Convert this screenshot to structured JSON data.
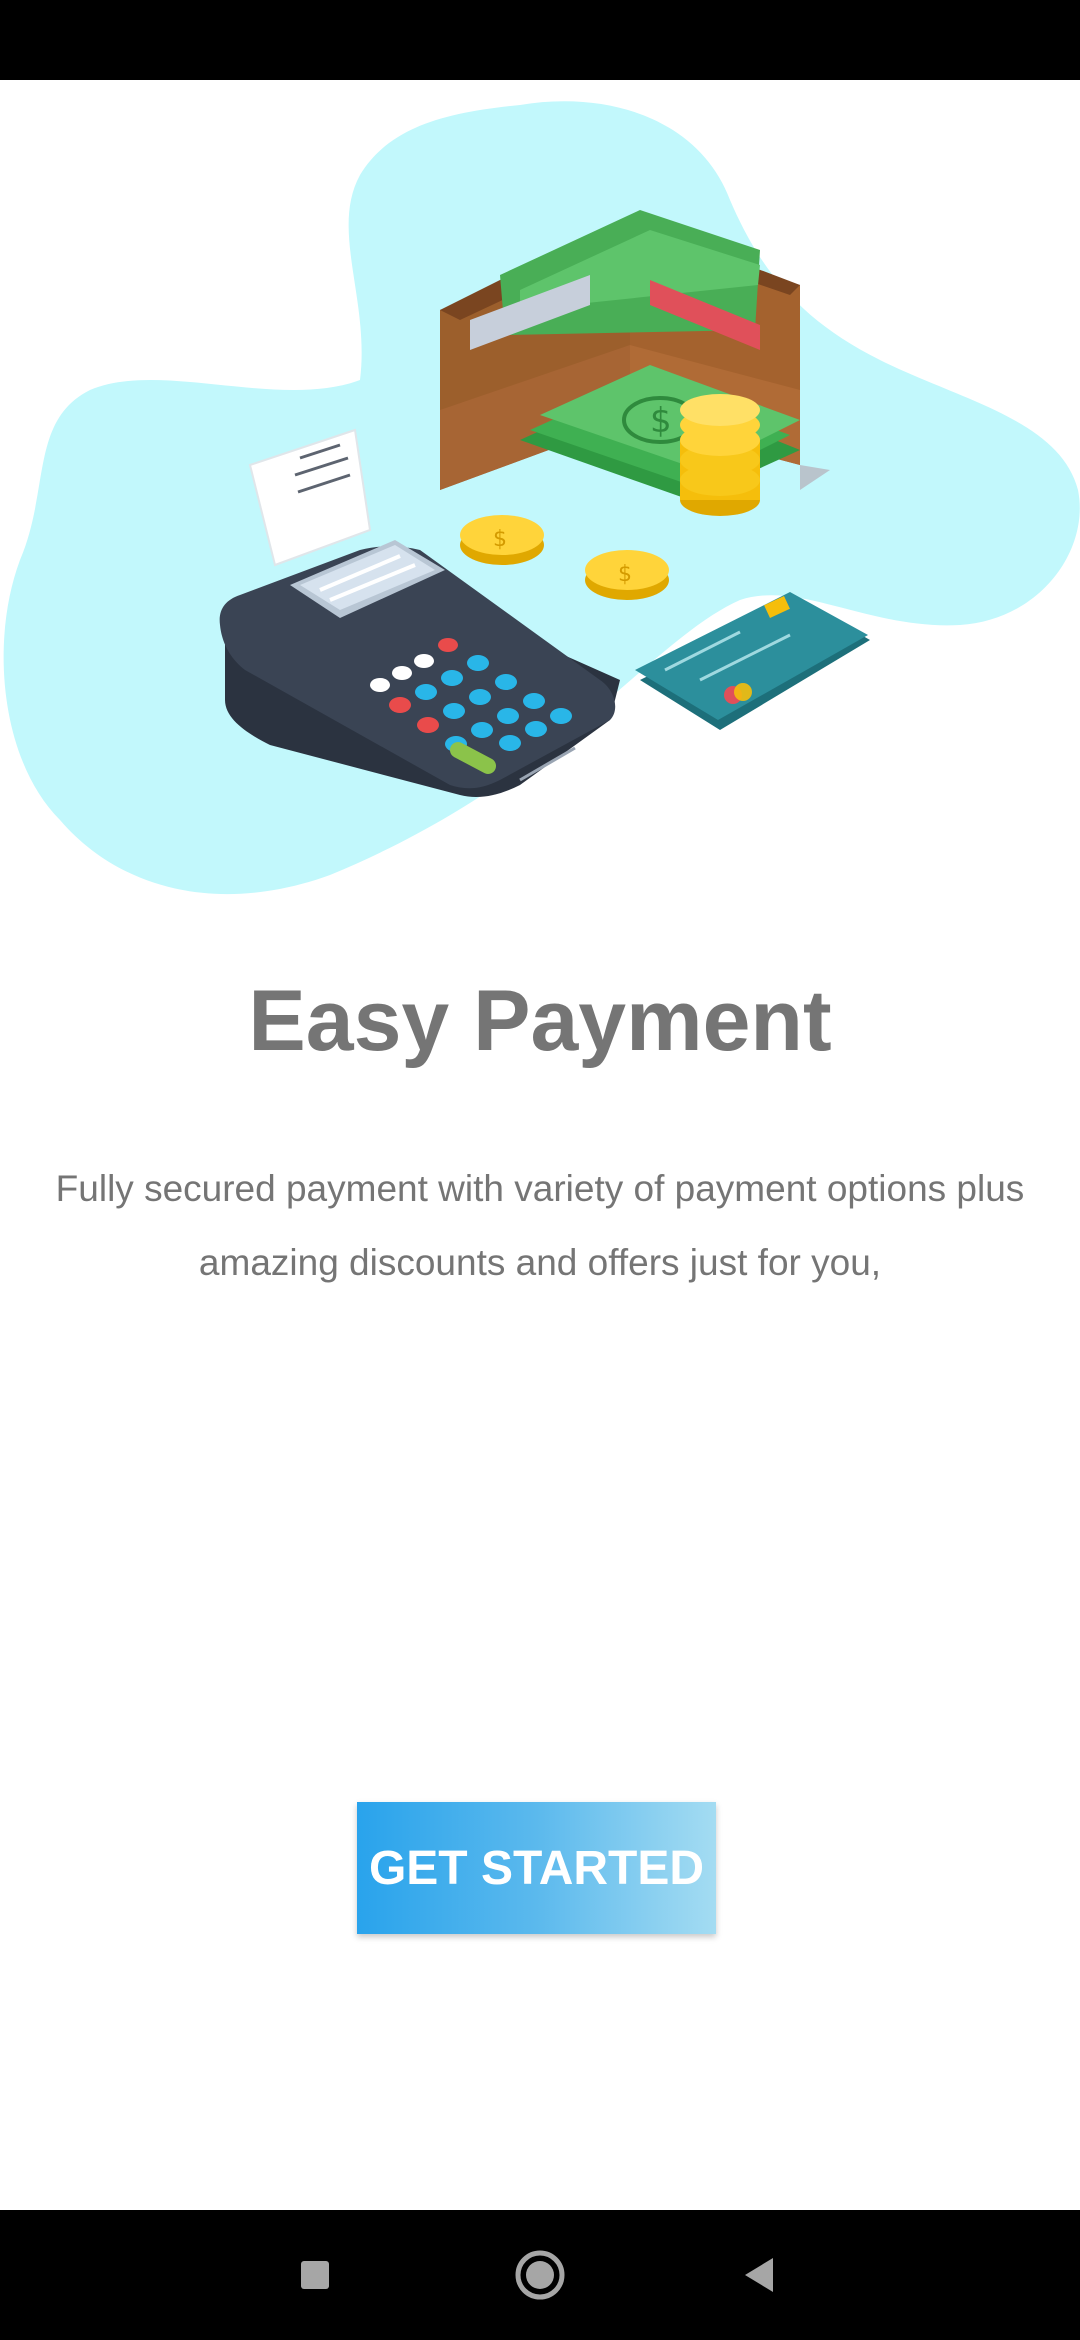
{
  "onboarding": {
    "title": "Easy Payment",
    "description": "Fully secured payment with variety of payment options plus amazing discounts and offers just for you,",
    "illustration": "payment-terminal-wallet-illustration",
    "cta_label": "GET STARTED"
  },
  "navigation_bar": {
    "recent_icon": "square-recents-icon",
    "home_icon": "circle-home-icon",
    "back_icon": "triangle-back-icon"
  },
  "colors": {
    "title_text": "#757575",
    "body_text": "#757575",
    "button_gradient_start": "#29a3ec",
    "button_gradient_end": "#a4dcf2",
    "button_text": "#ffffff",
    "blob": "#c2f8fc",
    "system_bars": "#000000"
  }
}
